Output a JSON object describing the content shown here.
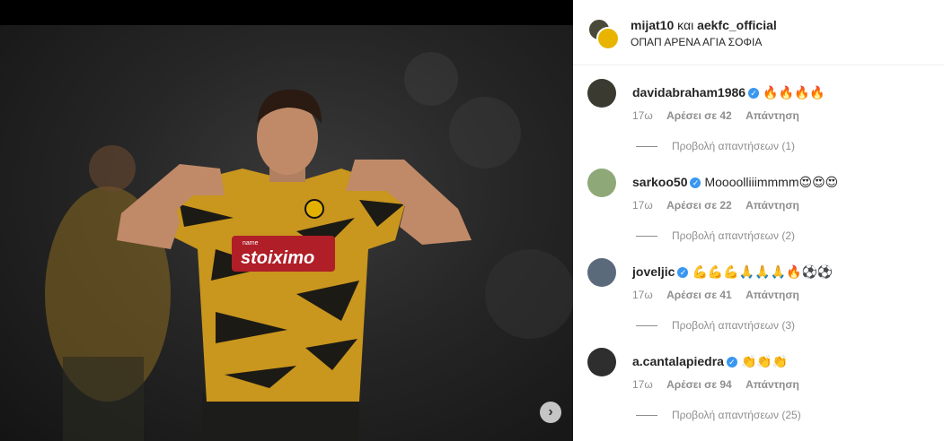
{
  "header": {
    "user1": "mijat10",
    "connector": "και",
    "user2": "aekfc_official",
    "location": "ΟΠΑΠ ΑΡΕΝΑ ΑΓΙΑ ΣΟΦΙΑ"
  },
  "post": {
    "sponsor_text": "stoiximo",
    "sponsor_small": "name",
    "next_icon": "chevron-right-icon"
  },
  "comments": [
    {
      "user": "davidabraham1986",
      "verified": true,
      "text": "🔥🔥🔥🔥",
      "time": "17ω",
      "likes": "Αρέσει σε 42",
      "reply": "Απάντηση",
      "view_replies": "Προβολή απαντήσεων (1)",
      "avatar_color": "#3a3a30"
    },
    {
      "user": "sarkoo50",
      "verified": true,
      "text": "Moooolliiimmmm😍😍😍",
      "time": "17ω",
      "likes": "Αρέσει σε 22",
      "reply": "Απάντηση",
      "view_replies": "Προβολή απαντήσεων (2)",
      "avatar_color": "#8fa878"
    },
    {
      "user": "joveljic",
      "verified": true,
      "text": "💪💪💪🙏🙏🙏🔥⚽⚽",
      "time": "17ω",
      "likes": "Αρέσει σε 41",
      "reply": "Απάντηση",
      "view_replies": "Προβολή απαντήσεων (3)",
      "avatar_color": "#5a6a7a"
    },
    {
      "user": "a.cantalapiedra",
      "verified": true,
      "text": "👏👏👏",
      "time": "17ω",
      "likes": "Αρέσει σε 94",
      "reply": "Απάντηση",
      "view_replies": "Προβολή απαντήσεων (25)",
      "avatar_color": "#2e2e2e"
    }
  ]
}
